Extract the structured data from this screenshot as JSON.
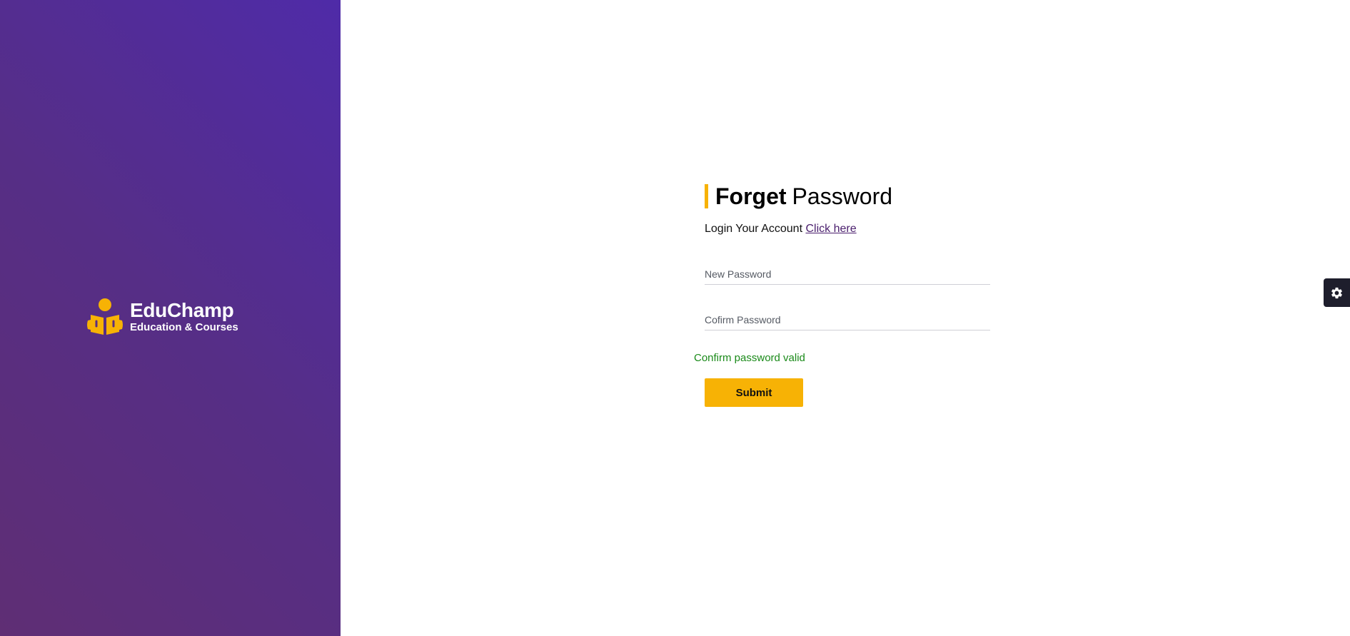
{
  "brand": {
    "name": "EduChamp",
    "tagline": "Education & Courses",
    "icon": "reader-icon",
    "accent_color": "#f7b205"
  },
  "form": {
    "title_bold": "Forget",
    "title_light": "Password",
    "subtitle": "Login Your Account",
    "subtitle_link": "Click here",
    "new_password_placeholder": "New Password",
    "confirm_password_placeholder": "Cofirm Password",
    "validation_message": "Confirm password valid",
    "submit_label": "Submit"
  },
  "settings": {
    "icon": "gear-icon"
  },
  "colors": {
    "left_panel_gradient_start": "#5f2e74",
    "left_panel_gradient_end": "#4f2ba8",
    "accent": "#f7b205",
    "valid": "#1a8a19",
    "link": "#4a1e6d"
  }
}
